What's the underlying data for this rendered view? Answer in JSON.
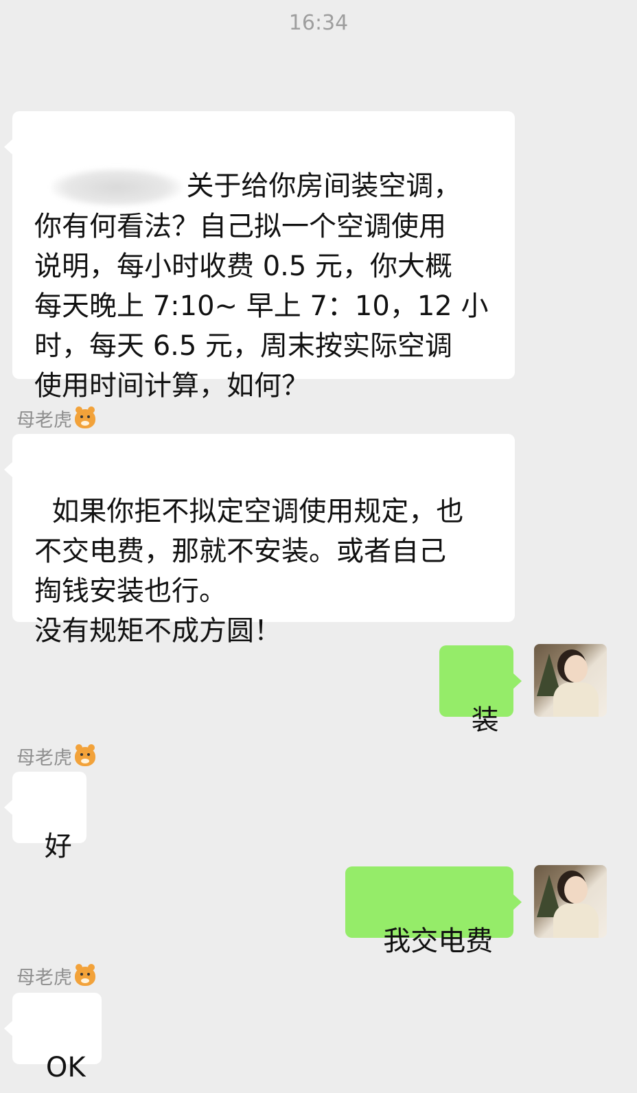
{
  "chat": {
    "timestamp": "16:34",
    "messages": [
      {
        "side": "left",
        "sender": "",
        "text": "关于给你房间装空调，\n你有何看法？自己拟一个空调使用\n说明，每小时收费 0.5 元，你大概\n每天晚上 7:10~ 早上 7：10，12 小\n时，每天 6.5 元，周末按实际空调\n使用时间计算，如何？"
      },
      {
        "side": "left",
        "sender": "母老虎",
        "sender_emoji": "tiger-face-icon",
        "text": "如果你拒不拟定空调使用规定，也\n不交电费，那就不安装。或者自己\n掏钱安装也行。\n没有规矩不成方圆！"
      },
      {
        "side": "right",
        "text": "装"
      },
      {
        "side": "left",
        "sender": "母老虎",
        "sender_emoji": "tiger-face-icon",
        "text": "好"
      },
      {
        "side": "right",
        "text": "我交电费"
      },
      {
        "side": "left",
        "sender": "母老虎",
        "sender_emoji": "tiger-face-icon",
        "text": "OK"
      }
    ]
  },
  "colors": {
    "background": "#ededed",
    "left_bubble": "#ffffff",
    "right_bubble": "#95ec69"
  }
}
